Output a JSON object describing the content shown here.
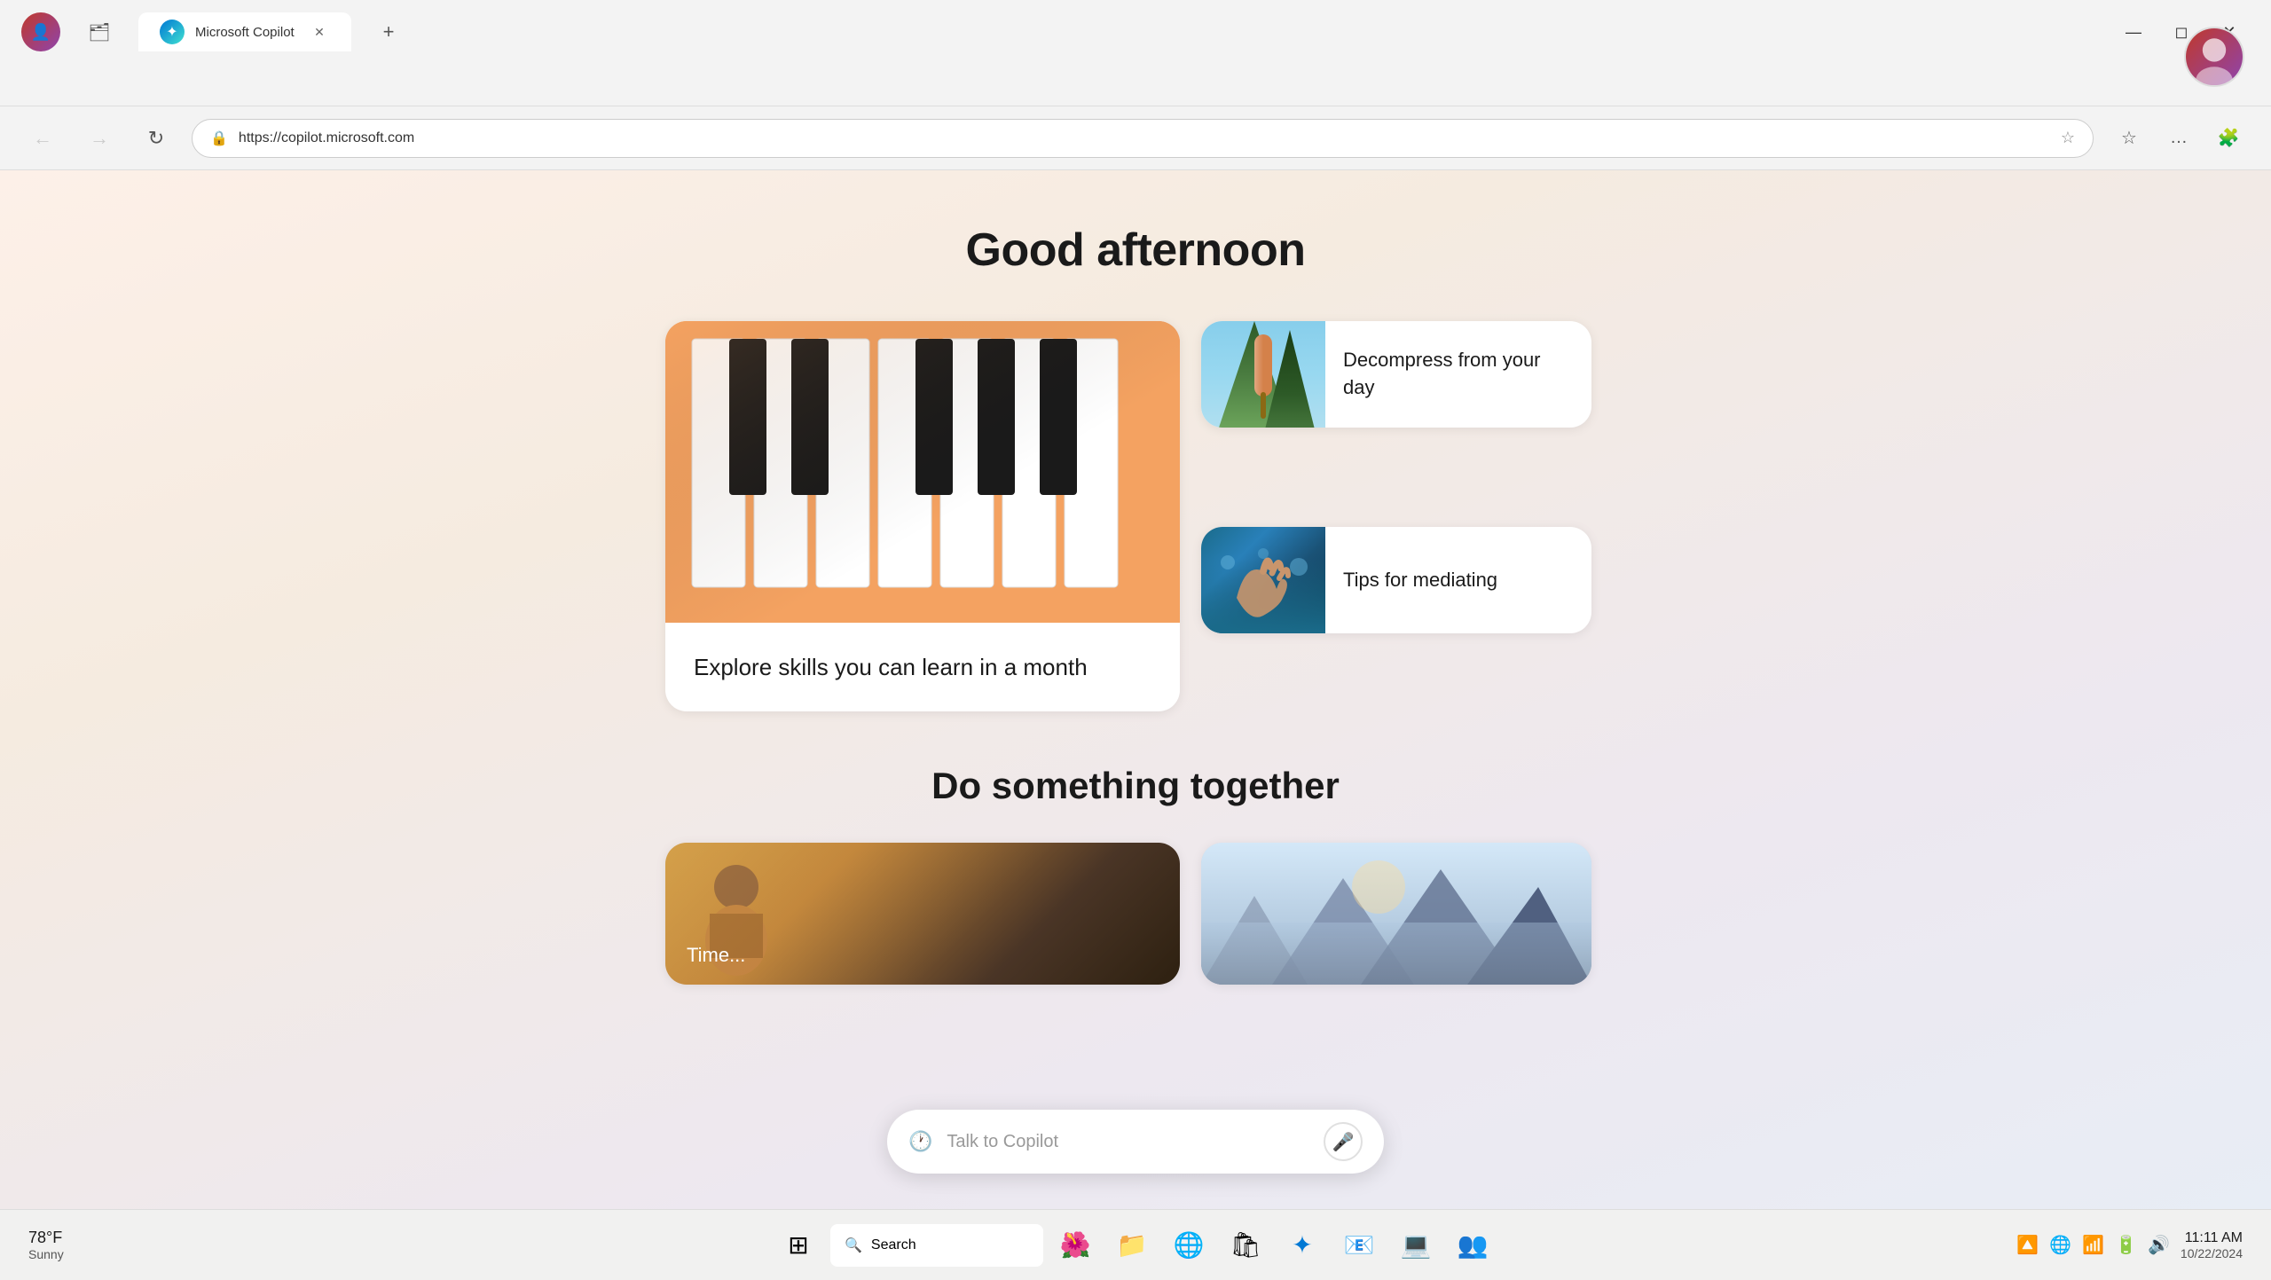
{
  "browser": {
    "tab": {
      "label": "Microsoft Copilot",
      "favicon_color": "#0078d4",
      "favicon_symbol": "✦"
    },
    "address": "https://copilot.microsoft.com",
    "new_tab_symbol": "+",
    "close_symbol": "✕"
  },
  "nav": {
    "back_symbol": "←",
    "forward_symbol": "→",
    "refresh_symbol": "↻",
    "home_symbol": "⌂",
    "lock_symbol": "🔒",
    "favorites_symbol": "☆",
    "more_symbol": "…",
    "extensions_symbol": "🧩"
  },
  "page": {
    "greeting": "Good afternoon",
    "card_large": {
      "text": "Explore skills you can learn in a month"
    },
    "card_small_1": {
      "text": "Decompress from your day"
    },
    "card_small_2": {
      "text": "Tips for mediating"
    },
    "section_title": "Do something together",
    "do_card_1": {
      "label": "Time..."
    },
    "do_card_2": {
      "label": ""
    },
    "copilot_bar": {
      "placeholder": "Talk to Copilot",
      "history_symbol": "🕐",
      "mic_symbol": "🎤"
    }
  },
  "taskbar": {
    "weather": {
      "temp": "78°F",
      "desc": "Sunny"
    },
    "search_placeholder": "Search",
    "search_icon": "🔍",
    "windows_icon": "⊞",
    "apps": [
      {
        "name": "Teams",
        "symbol": "👥"
      },
      {
        "name": "Edge",
        "symbol": "🌐"
      },
      {
        "name": "File Explorer",
        "symbol": "📁"
      },
      {
        "name": "Store",
        "symbol": "🛍"
      },
      {
        "name": "Copilot",
        "symbol": "✦"
      },
      {
        "name": "Mail",
        "symbol": "📧"
      },
      {
        "name": "Photos",
        "symbol": "🌺"
      },
      {
        "name": "Dev",
        "symbol": "💻"
      }
    ],
    "clock": {
      "time": "11:11 AM",
      "date": "10/22/2024"
    },
    "system_icons": [
      "🔼",
      "🌐",
      "📶",
      "🔋",
      "🔊"
    ]
  },
  "user_avatar": {
    "symbol": "👤",
    "alt": "User profile"
  }
}
